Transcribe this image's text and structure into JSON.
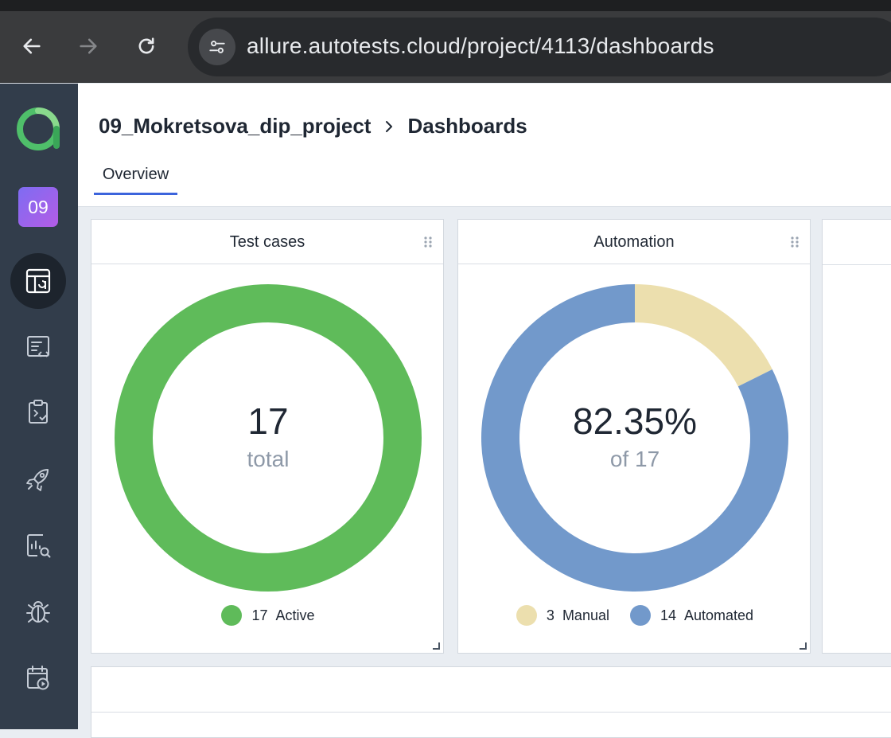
{
  "browser": {
    "url": "allure.autotests.cloud/project/4113/dashboards",
    "back_icon": "arrow-left-icon",
    "forward_icon": "arrow-right-icon",
    "reload_icon": "reload-icon",
    "site_settings_icon": "tune-icon"
  },
  "sidebar": {
    "project_badge": "09",
    "items": [
      {
        "name": "dashboards",
        "icon": "dashboard-icon",
        "active": true
      },
      {
        "name": "test-cases",
        "icon": "test-cases-icon",
        "active": false
      },
      {
        "name": "test-plans",
        "icon": "clipboard-check-icon",
        "active": false
      },
      {
        "name": "launches",
        "icon": "rocket-icon",
        "active": false
      },
      {
        "name": "analytics",
        "icon": "report-search-icon",
        "active": false
      },
      {
        "name": "defects",
        "icon": "bug-icon",
        "active": false
      },
      {
        "name": "jobs",
        "icon": "calendar-play-icon",
        "active": false
      }
    ]
  },
  "header": {
    "project_name": "09_Mokretsova_dip_project",
    "page_title": "Dashboards",
    "tabs": [
      {
        "label": "Overview",
        "active": true
      }
    ]
  },
  "widgets": {
    "test_cases": {
      "title": "Test cases",
      "value": "17",
      "sub": "total",
      "legend": [
        {
          "count": "17",
          "label": "Active",
          "color": "#5fbb5a"
        }
      ]
    },
    "automation": {
      "title": "Automation",
      "value": "82.35%",
      "sub": "of 17",
      "legend": [
        {
          "count": "3",
          "label": "Manual",
          "color": "#ecdfae"
        },
        {
          "count": "14",
          "label": "Automated",
          "color": "#7299cb"
        }
      ]
    }
  },
  "chart_data": [
    {
      "type": "pie",
      "title": "Test cases",
      "categories": [
        "Active"
      ],
      "values": [
        17
      ],
      "colors": [
        "#5fbb5a"
      ]
    },
    {
      "type": "pie",
      "title": "Automation",
      "categories": [
        "Manual",
        "Automated"
      ],
      "values": [
        3,
        14
      ],
      "colors": [
        "#ecdfae",
        "#7299cb"
      ]
    }
  ]
}
